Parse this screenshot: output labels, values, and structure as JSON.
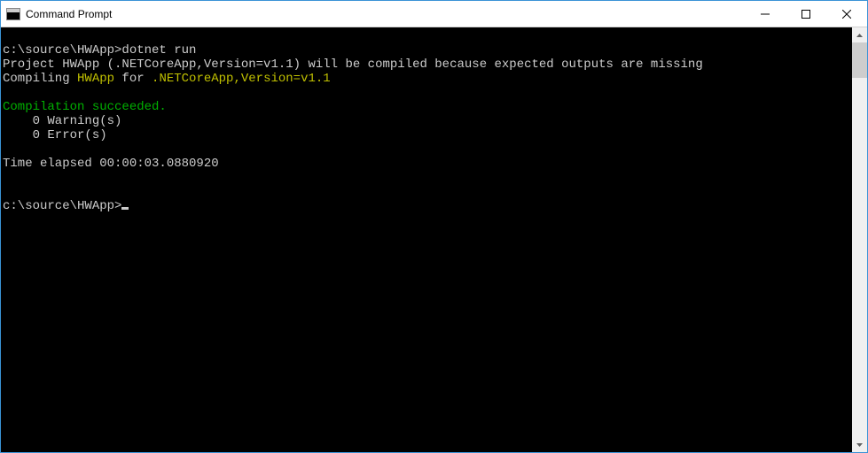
{
  "window": {
    "title": "Command Prompt"
  },
  "console": {
    "prompt1_path": "c:\\source\\HWApp>",
    "prompt1_cmd": "dotnet run",
    "line_project": "Project HWApp (.NETCoreApp,Version=v1.1) will be compiled because expected outputs are missing",
    "compiling_prefix": "Compiling ",
    "compiling_app": "HWApp",
    "compiling_mid": " for ",
    "compiling_target": ".NETCoreApp,Version=v1.1",
    "blank1": "",
    "compilation_result": "Compilation succeeded.",
    "warnings_line": "    0 Warning(s)",
    "errors_line": "    0 Error(s)",
    "blank2": "",
    "time_line": "Time elapsed 00:00:03.0880920",
    "blank3": "",
    "blank4": "",
    "prompt2_path": "c:\\source\\HWApp>"
  }
}
